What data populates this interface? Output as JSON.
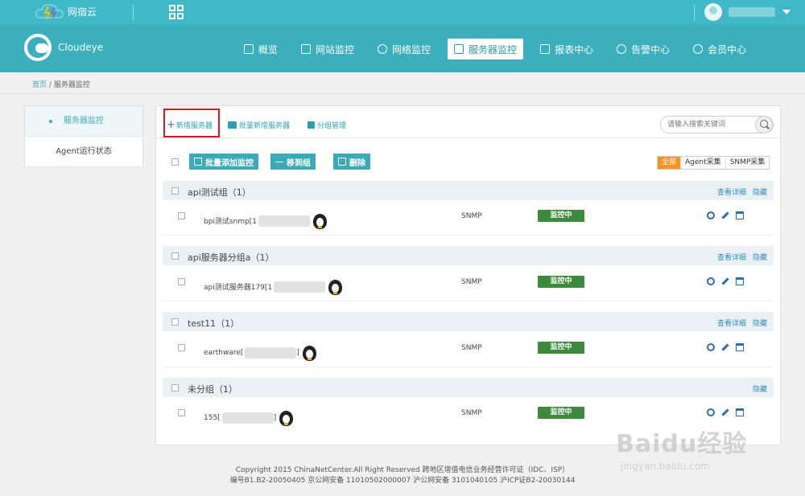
{
  "topbar": {
    "brand_name": "网宿云"
  },
  "navbar": {
    "logo_text": "Cloudeye",
    "items": [
      {
        "label": "概览",
        "icon": "home-icon",
        "active": false
      },
      {
        "label": "网站监控",
        "icon": "monitor-icon",
        "active": false
      },
      {
        "label": "网络监控",
        "icon": "network-icon",
        "active": false
      },
      {
        "label": "服务器监控",
        "icon": "server-icon",
        "active": true
      },
      {
        "label": "报表中心",
        "icon": "report-icon",
        "active": false
      },
      {
        "label": "告警中心",
        "icon": "alert-icon",
        "active": false
      },
      {
        "label": "会员中心",
        "icon": "user-icon",
        "active": false
      }
    ]
  },
  "breadcrumb": {
    "home": "首页",
    "separator": "/",
    "current": "服务器监控"
  },
  "sidebar": {
    "items": [
      {
        "label": "服务器监控",
        "active": true
      },
      {
        "label": "Agent运行状态",
        "active": false
      }
    ]
  },
  "toolbar": {
    "add_server": "新增服务器",
    "batch_add_server": "批量新增服务器",
    "group_manage": "分组管理",
    "search_placeholder": "请输入搜索关键词"
  },
  "actions": {
    "batch_add_monitor": "批量添加监控",
    "move_to_group": "移到组",
    "delete": "删除"
  },
  "filters": {
    "all": "全部",
    "agent": "Agent采集",
    "snmp": "SNMP采集"
  },
  "group_links": {
    "view_detail": "查看详细",
    "hide": "隐藏"
  },
  "groups": [
    {
      "name": "api测试组（1）",
      "server": {
        "name": "bpi测试snmp[1",
        "protocol": "SNMP",
        "status": "监控中"
      }
    },
    {
      "name": "api服务器分组a（1）",
      "server": {
        "name": "api测试服务器179[1",
        "protocol": "SNMP",
        "status": "监控中"
      }
    },
    {
      "name": "test11（1）",
      "server": {
        "name": "earthware[",
        "suffix": "]",
        "protocol": "SNMP",
        "status": "监控中"
      }
    },
    {
      "name": "未分组（1）",
      "server": {
        "name": "155[",
        "suffix": "]",
        "protocol": "SNMP",
        "status": "监控中"
      }
    }
  ],
  "footer": {
    "line1": "Copyright 2015 ChinaNetCenter.All Right Reserved 跨地区增值电信业务经营许可证（IDC、ISP）",
    "line2": "编号B1.B2-20050405 京公网安备 11010502000007 沪公网安备 3101040105 沪ICP证B2-20030144"
  },
  "watermark": {
    "big": "Baidu经验",
    "small": "jingyan.baidu.com"
  },
  "colors": {
    "primary": "#3bafbd",
    "status_green": "#3e8a3c",
    "filter_active": "#f7941d",
    "highlight_red": "#e0141a"
  }
}
